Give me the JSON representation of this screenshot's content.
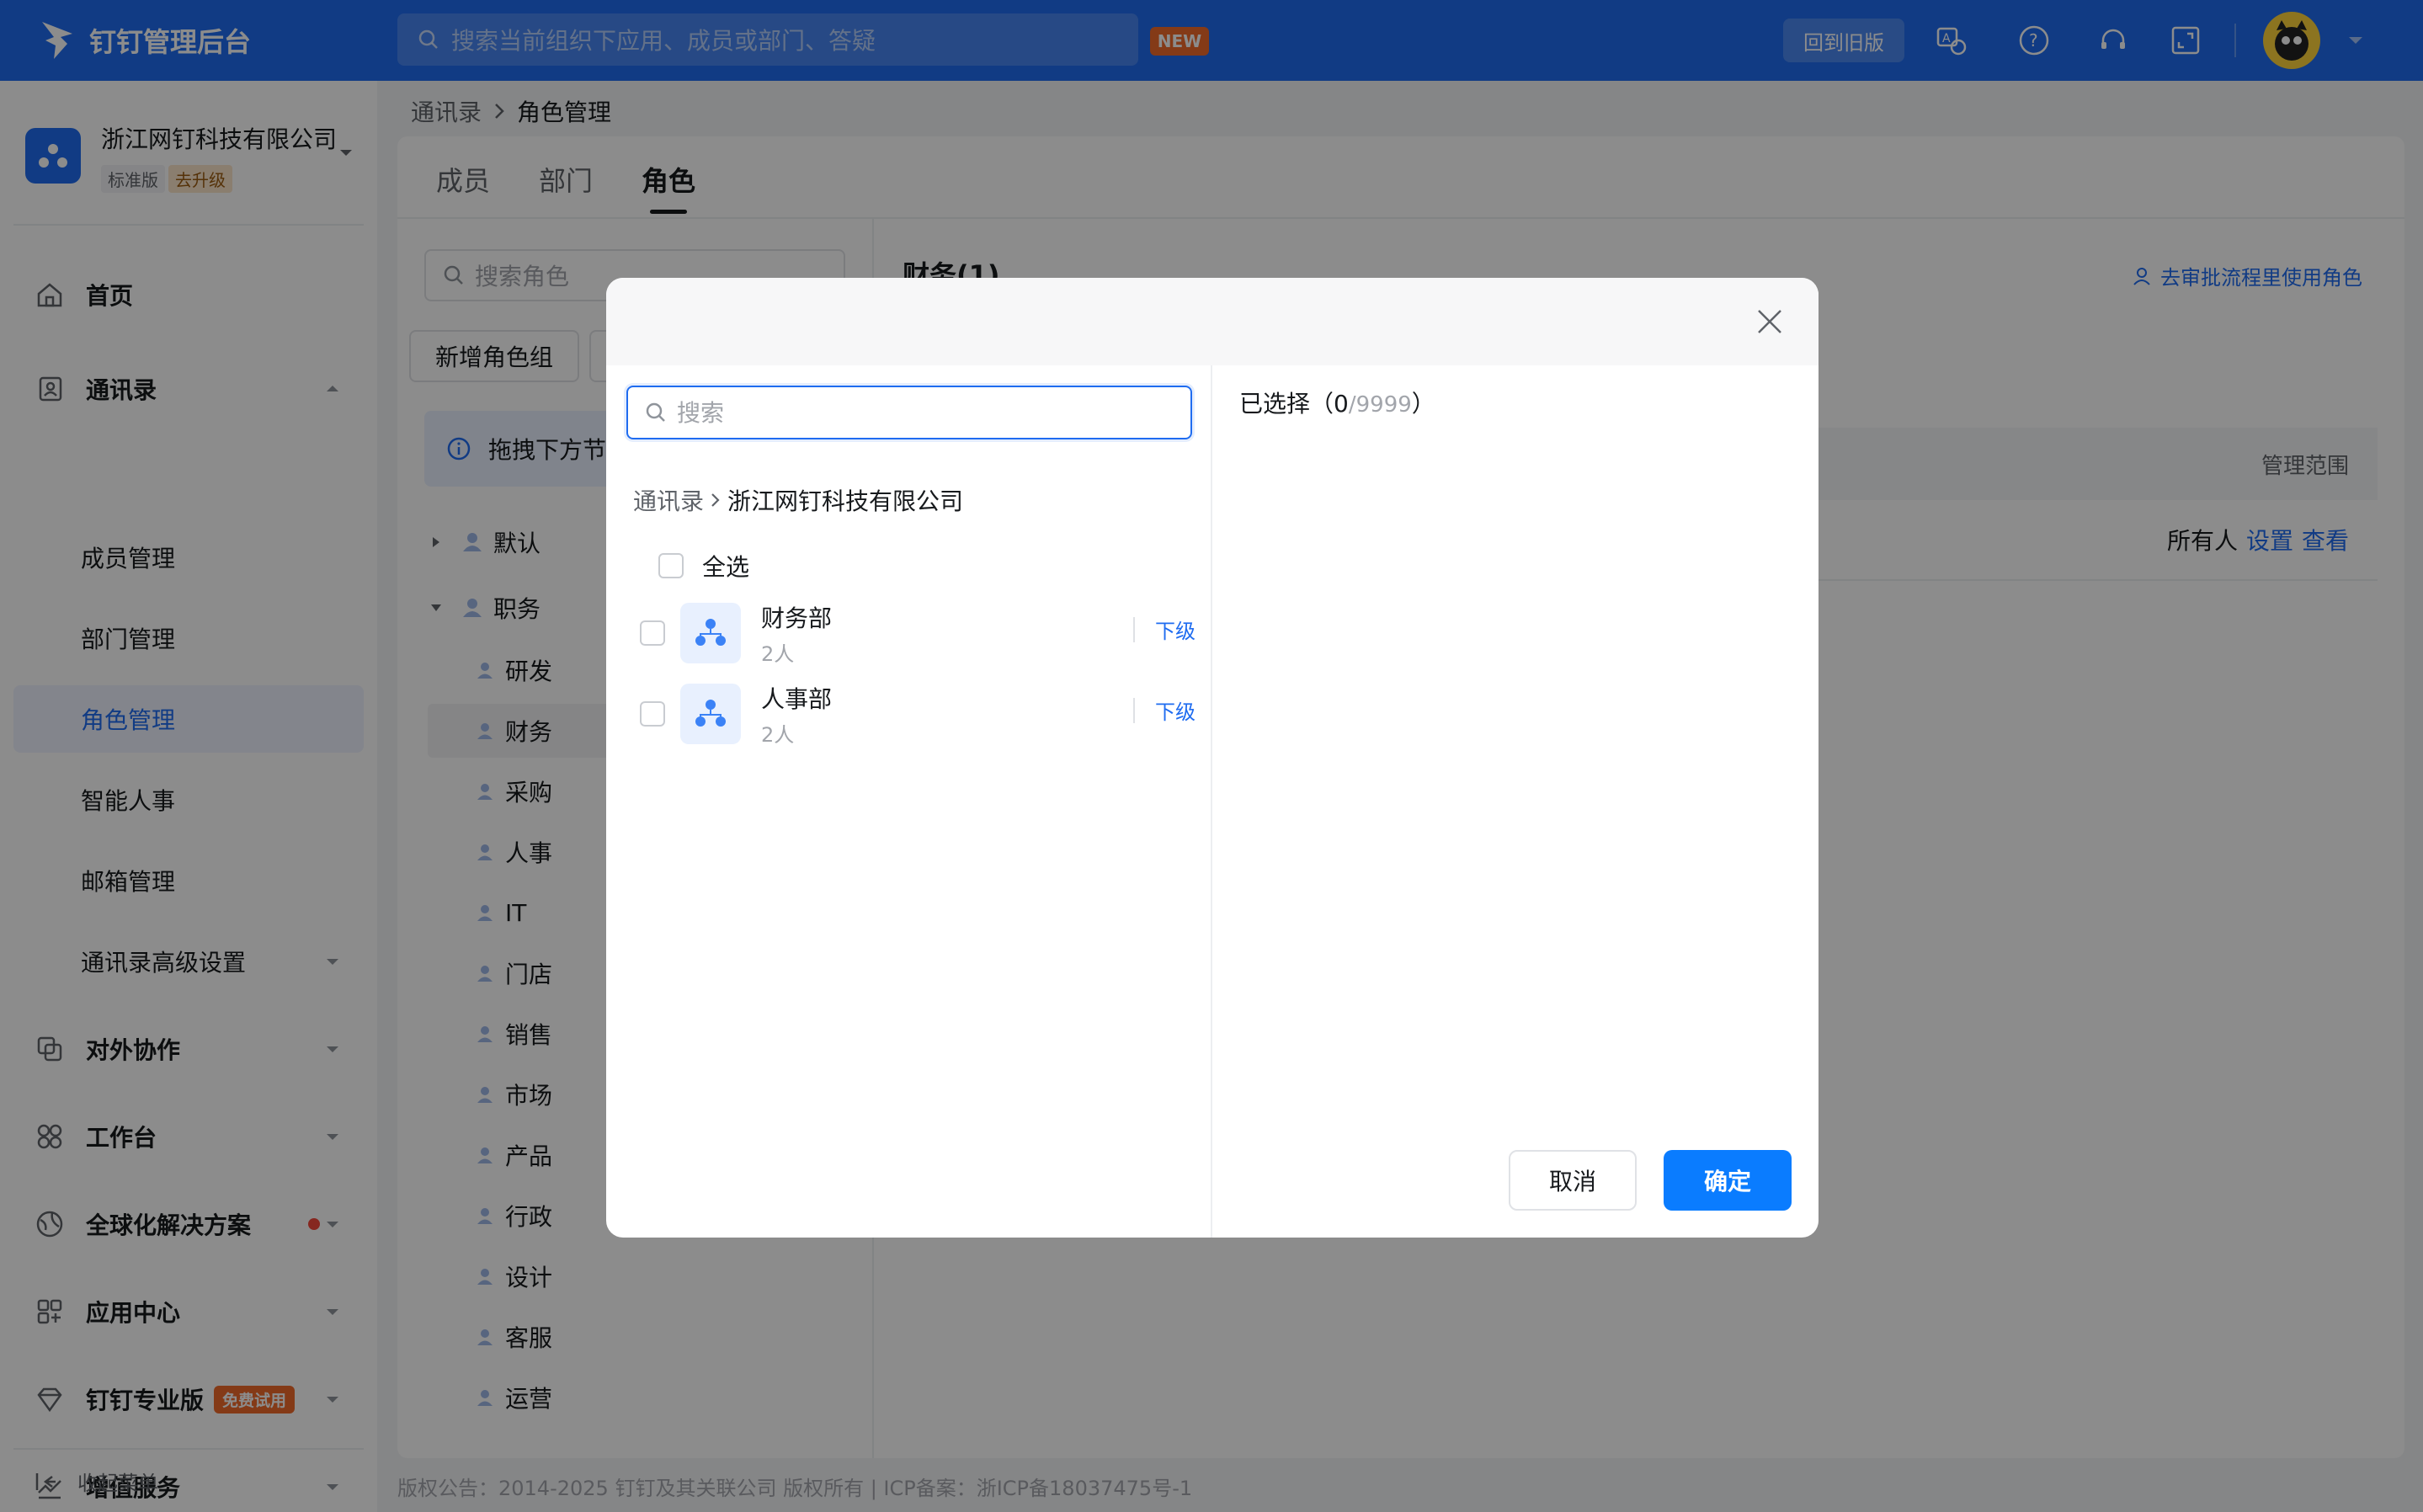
{
  "topbar": {
    "app_title": "钉钉管理后台",
    "search_placeholder": "搜索当前组织下应用、成员或部门、答疑",
    "new_badge": "NEW",
    "old_version": "回到旧版"
  },
  "sidebar": {
    "org_name": "浙江网钉科技有限公司",
    "tag_standard": "标准版",
    "tag_upgrade": "去升级",
    "items": {
      "home": "首页",
      "contacts": "通讯录",
      "members": "成员管理",
      "departments": "部门管理",
      "roles": "角色管理",
      "smart_hr": "智能人事",
      "mailbox": "邮箱管理",
      "contacts_adv": "通讯录高级设置",
      "external": "对外协作",
      "workbench": "工作台",
      "global": "全球化解决方案",
      "app_center": "应用中心",
      "pro": "钉钉专业版",
      "pro_badge": "免费试用",
      "value_added": "增值服务"
    },
    "collapse": "收起菜单"
  },
  "main": {
    "breadcrumb": [
      "通讯录",
      "角色管理"
    ],
    "tabs": [
      "成员",
      "部门",
      "角色"
    ],
    "role_search_placeholder": "搜索角色",
    "add_group_btn": "新增角色组",
    "info_text": "拖拽下方节",
    "tree": {
      "default": "默认",
      "position": "职务",
      "roles": [
        "研发",
        "财务",
        "采购",
        "人事",
        "IT",
        "门店",
        "销售",
        "市场",
        "产品",
        "行政",
        "设计",
        "客服",
        "运营"
      ]
    },
    "detail_title": "财务(1)",
    "approve_link": "去审批流程里使用角色",
    "table_head": "管理范围",
    "row_scope": "所有人",
    "row_set": "设置",
    "row_view": "查看"
  },
  "footer": "版权公告：2014-2025 钉钉及其关联公司 版权所有 | ICP备案：浙ICP备18037475号-1",
  "modal": {
    "search_placeholder": "搜索",
    "crumb_root": "通讯录",
    "crumb_org": "浙江网钉科技有限公司",
    "select_all": "全选",
    "departments": [
      {
        "name": "财务部",
        "count": "2人",
        "sub": "下级"
      },
      {
        "name": "人事部",
        "count": "2人",
        "sub": "下级"
      }
    ],
    "selected_prefix": "已选择（",
    "selected_count": "0",
    "selected_max": "/9999",
    "selected_suffix": "）",
    "cancel": "取消",
    "confirm": "确定"
  },
  "colors": {
    "brand": "#1f6cf0",
    "confirm": "#0a7cff",
    "badge_orange": "#f06a2b"
  }
}
